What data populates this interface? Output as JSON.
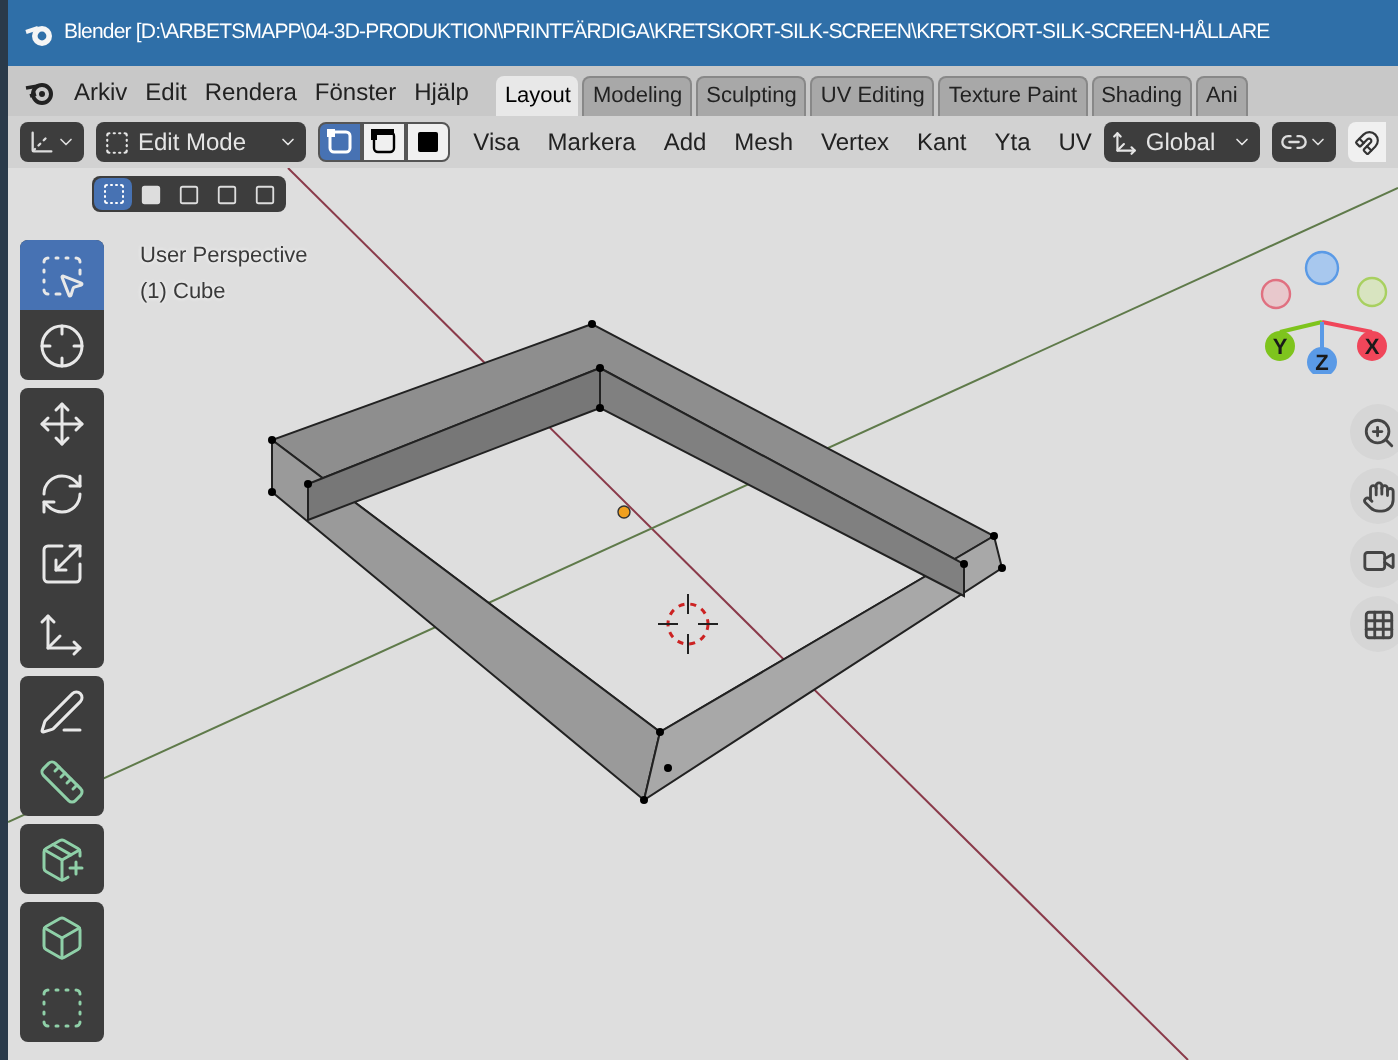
{
  "window": {
    "title": "Blender [D:\\ARBETSMAPP\\04-3D-PRODUKTION\\PRINTFÄRDIGA\\KRETSKORT-SILK-SCREEN\\KRETSKORT-SILK-SCREEN-HÅLLARE"
  },
  "menu": [
    "Arkiv",
    "Edit",
    "Rendera",
    "Fönster",
    "Hjälp"
  ],
  "workspace_tabs": [
    {
      "label": "Layout",
      "selected": true
    },
    {
      "label": "Modeling",
      "selected": false
    },
    {
      "label": "Sculpting",
      "selected": false
    },
    {
      "label": "UV Editing",
      "selected": false
    },
    {
      "label": "Texture Paint",
      "selected": false
    },
    {
      "label": "Shading",
      "selected": false
    },
    {
      "label": "Ani",
      "selected": false
    }
  ],
  "header": {
    "mode": "Edit Mode",
    "select_modes": [
      {
        "kind": "vertex",
        "selected": true
      },
      {
        "kind": "edge",
        "selected": false
      },
      {
        "kind": "face",
        "selected": false
      }
    ],
    "menus": [
      "Visa",
      "Markera",
      "Add",
      "Mesh",
      "Vertex",
      "Kant",
      "Yta",
      "UV"
    ],
    "orientation": "Global"
  },
  "box_select_modes": [
    {
      "kind": "new",
      "selected": true
    },
    {
      "kind": "extend",
      "selected": false
    },
    {
      "kind": "subtract",
      "selected": false
    },
    {
      "kind": "invert",
      "selected": false
    },
    {
      "kind": "intersect",
      "selected": false
    }
  ],
  "viewport": {
    "view_name": "User Perspective",
    "object_info": "(1) Cube"
  },
  "toolbar": {
    "groups": [
      {
        "tools": [
          {
            "kind": "select",
            "selected": true
          },
          {
            "kind": "cursor",
            "selected": false
          }
        ]
      },
      {
        "tools": [
          {
            "kind": "move",
            "selected": false
          },
          {
            "kind": "rotate",
            "selected": false
          },
          {
            "kind": "scale",
            "selected": false
          },
          {
            "kind": "transform",
            "selected": false
          }
        ]
      },
      {
        "tools": [
          {
            "kind": "annotate",
            "selected": false
          },
          {
            "kind": "measure",
            "selected": false
          }
        ]
      },
      {
        "tools": [
          {
            "kind": "add_cube",
            "selected": false
          }
        ]
      },
      {
        "tools": [
          {
            "kind": "extrude",
            "selected": false
          },
          {
            "kind": "inset",
            "selected": false
          }
        ]
      }
    ]
  },
  "gizmo": {
    "axes": [
      {
        "label": "Y",
        "color": "#7ec41d"
      },
      {
        "label": "X",
        "color": "#f0465a"
      },
      {
        "label": "Z",
        "color": "#5a9ae6"
      }
    ]
  },
  "nav_buttons": [
    {
      "kind": "zoom"
    },
    {
      "kind": "pan"
    },
    {
      "kind": "camera"
    },
    {
      "kind": "ortho"
    }
  ]
}
